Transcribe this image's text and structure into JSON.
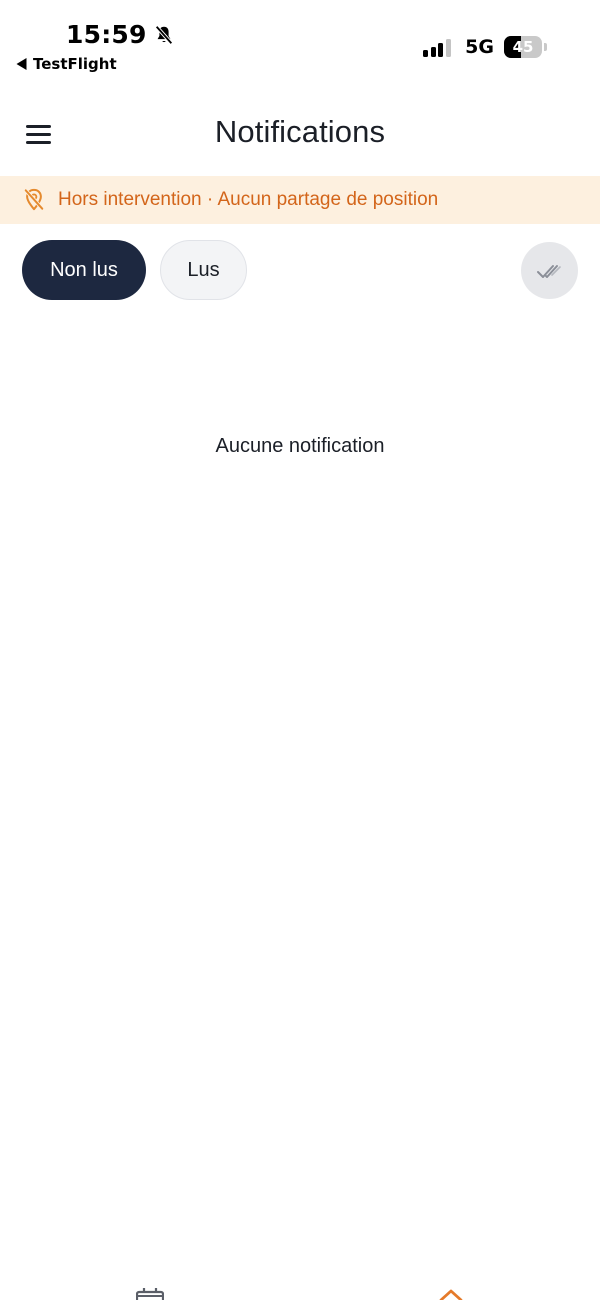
{
  "status_bar": {
    "time": "15:59",
    "back_app": "TestFlight",
    "network": "5G",
    "battery": "45",
    "battery_level": 0.45,
    "signal_bars": 3
  },
  "header": {
    "title": "Notifications",
    "menu_icon": "hamburger-menu-icon"
  },
  "banner": {
    "text": "Hors intervention · Aucun partage de position",
    "icon": "location-off-icon",
    "text_color": "#d3651a",
    "background": "#fdf0df"
  },
  "tabs": [
    {
      "label": "Non lus",
      "active": true
    },
    {
      "label": "Lus",
      "active": false
    }
  ],
  "actions": {
    "mark_all_read_icon": "double-check-icon"
  },
  "empty_state": {
    "message": "Aucune notification"
  },
  "bottom_nav": {
    "items": [
      {
        "icon": "calendar-icon"
      },
      {
        "icon": "home-icon",
        "active": true
      }
    ]
  },
  "colors": {
    "primary_dark": "#1d2840",
    "accent": "#e57a2a"
  }
}
